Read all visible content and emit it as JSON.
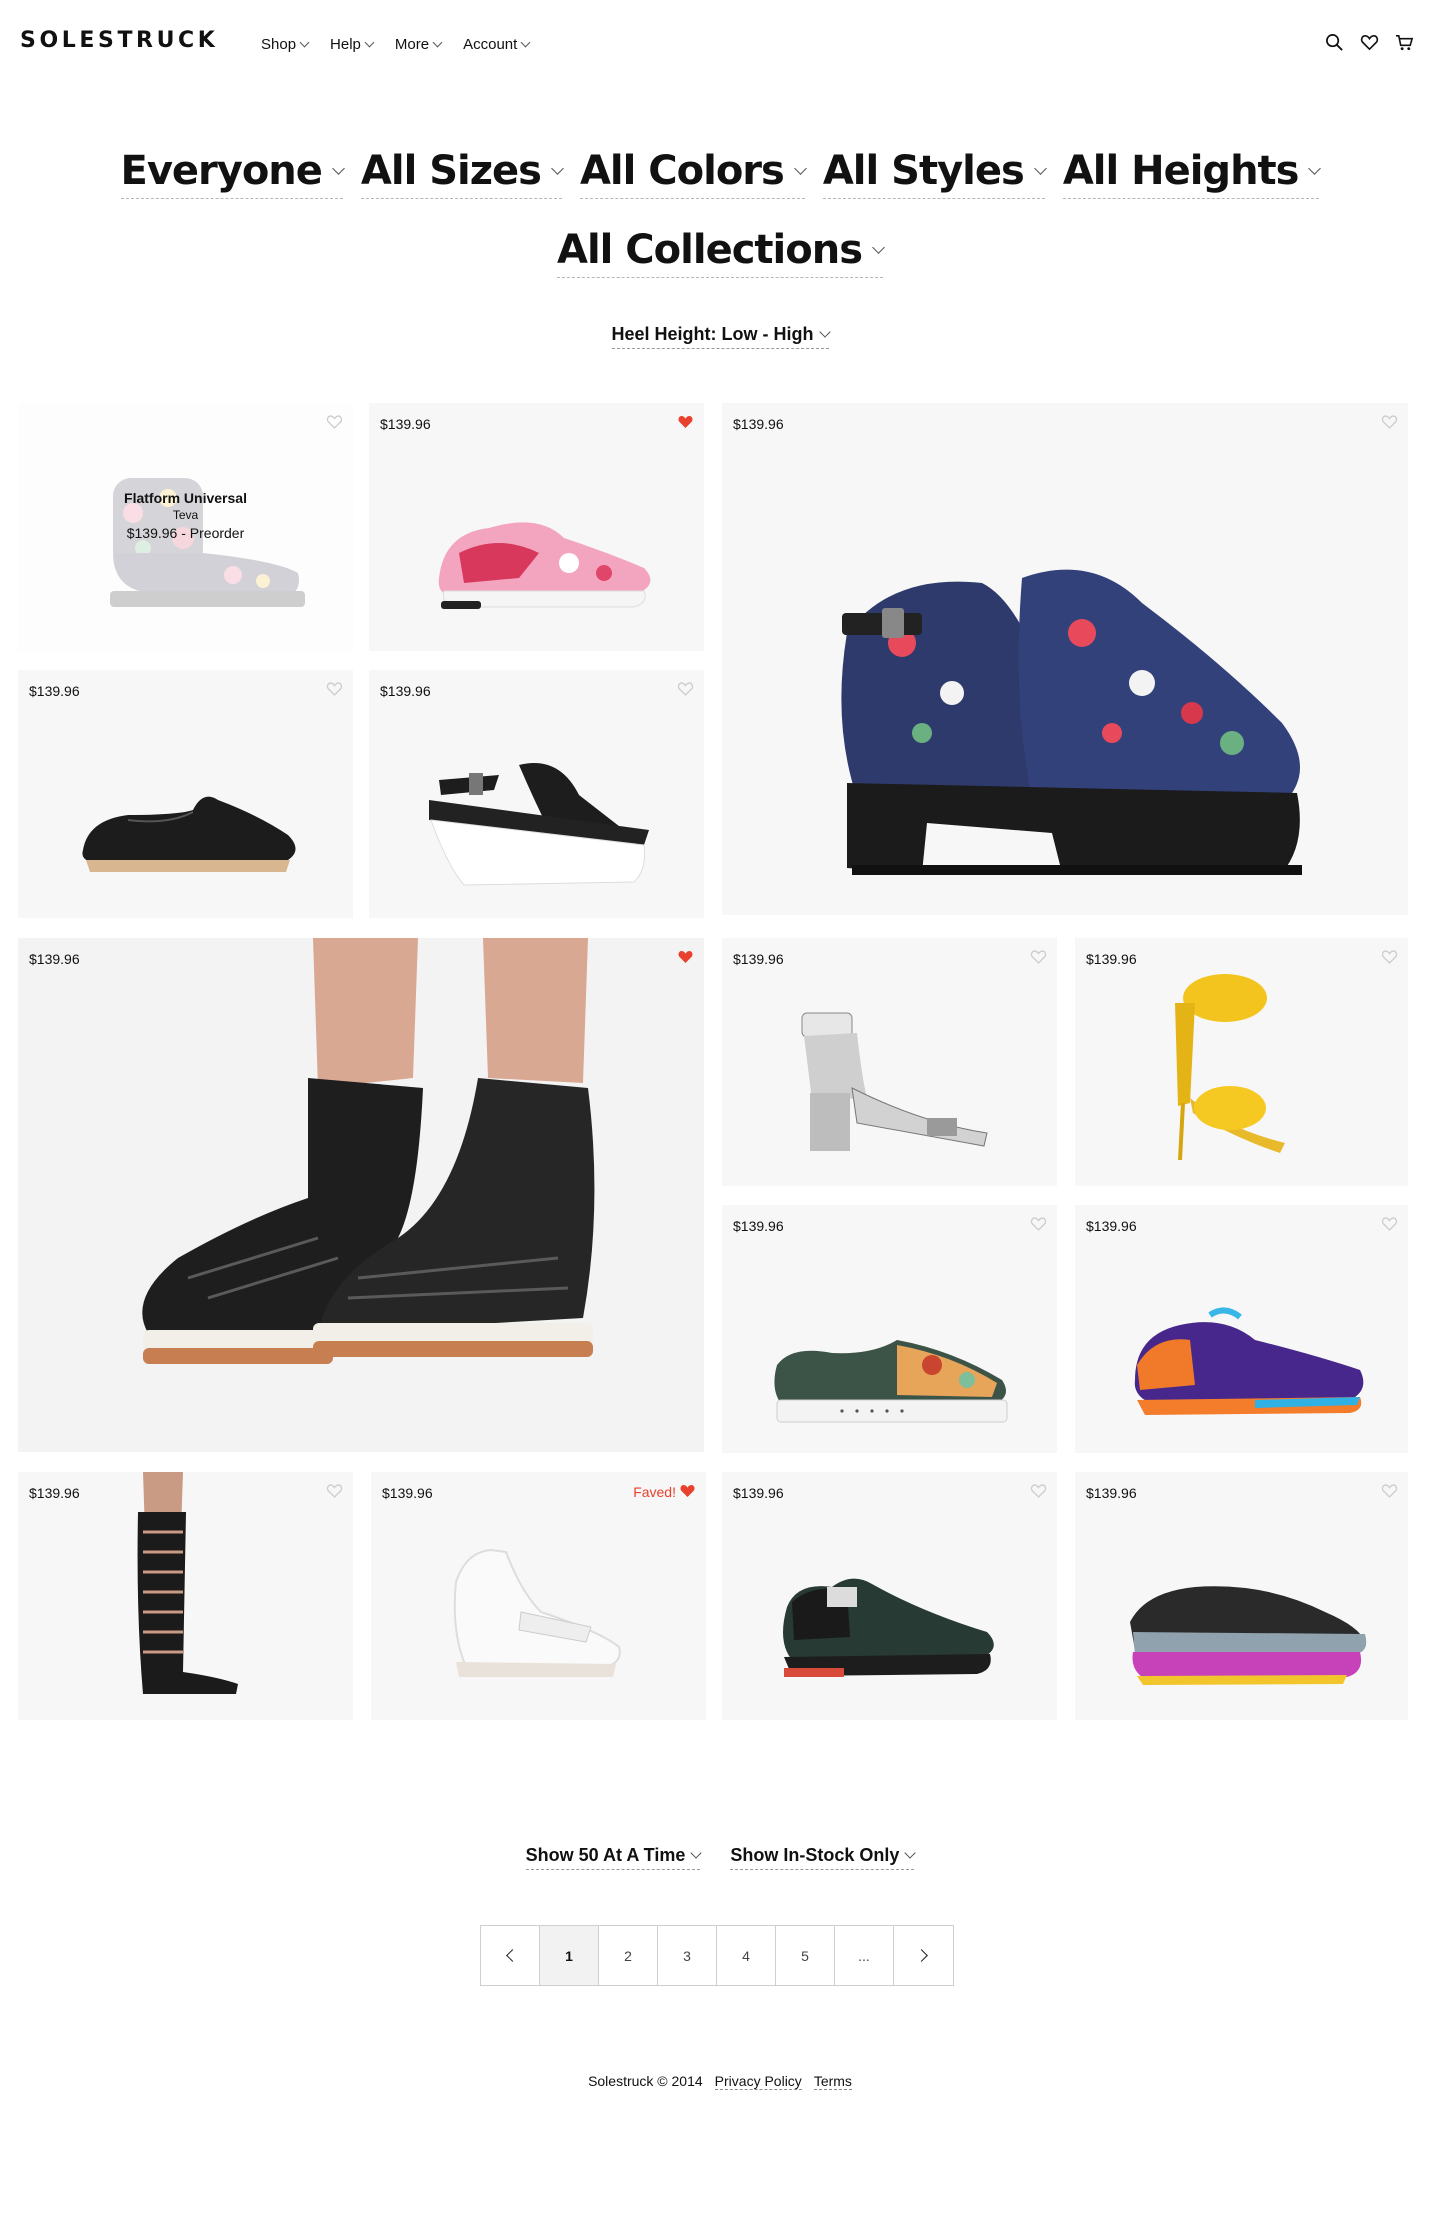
{
  "brand": {
    "name": "SOLESTRUCK"
  },
  "nav": [
    {
      "label": "Shop"
    },
    {
      "label": "Help"
    },
    {
      "label": "More"
    },
    {
      "label": "Account"
    }
  ],
  "header_icons": [
    "search-icon",
    "heart-icon",
    "cart-icon"
  ],
  "filters": [
    {
      "label": "Everyone"
    },
    {
      "label": "All Sizes"
    },
    {
      "label": "All Colors"
    },
    {
      "label": "All Styles"
    },
    {
      "label": "All Heights"
    },
    {
      "label": "All Collections"
    }
  ],
  "sort": {
    "label": "Heel Height: Low - High"
  },
  "accent_color": "#e8412d",
  "products": [
    {
      "id": "p1",
      "price": "$139.96",
      "faved": false,
      "hover": {
        "name": "Flatform Universal",
        "brand": "Teva",
        "price": "$139.96 - Preorder"
      }
    },
    {
      "id": "p2",
      "price": "$139.96",
      "faved": true
    },
    {
      "id": "p3",
      "price": "$139.96",
      "faved": false
    },
    {
      "id": "p4",
      "price": "$139.96",
      "faved": false
    },
    {
      "id": "p5",
      "price": "$139.96",
      "faved": false
    },
    {
      "id": "p6",
      "price": "$139.96",
      "faved": true
    },
    {
      "id": "p7",
      "price": "$139.96",
      "faved": false
    },
    {
      "id": "p8",
      "price": "$139.96",
      "faved": false
    },
    {
      "id": "p9",
      "price": "$139.96",
      "faved": false
    },
    {
      "id": "p10",
      "price": "$139.96",
      "faved": false
    },
    {
      "id": "p11",
      "price": "$139.96",
      "faved": false
    },
    {
      "id": "p12",
      "price": "$139.96",
      "faved": true,
      "faved_label": "Faved!"
    },
    {
      "id": "p13",
      "price": "$139.96",
      "faved": false
    },
    {
      "id": "p14",
      "price": "$139.96",
      "faved": false
    }
  ],
  "options": {
    "per_page": "Show 50 At A Time",
    "stock": "Show In-Stock Only"
  },
  "pagination": {
    "pages": [
      "1",
      "2",
      "3",
      "4",
      "5",
      "..."
    ],
    "current": "1"
  },
  "footer": {
    "copyright": "Solestruck © 2014",
    "privacy": "Privacy Policy",
    "terms": "Terms"
  }
}
